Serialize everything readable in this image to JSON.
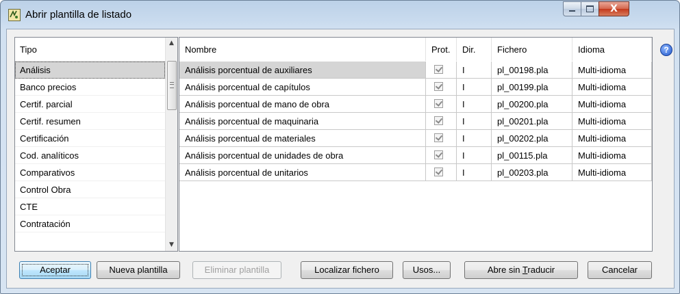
{
  "window": {
    "title": "Abrir plantilla de listado",
    "icon": "app-template-icon",
    "controls": {
      "minimize": "minimize-icon",
      "maximize": "maximize-icon",
      "close": "X"
    }
  },
  "left_list": {
    "header": "Tipo",
    "items": [
      {
        "label": "Análisis",
        "selected": true
      },
      {
        "label": "Banco precios"
      },
      {
        "label": "Certif. parcial"
      },
      {
        "label": "Certif. resumen"
      },
      {
        "label": "Certificación"
      },
      {
        "label": "Cod. analíticos"
      },
      {
        "label": "Comparativos"
      },
      {
        "label": "Control Obra"
      },
      {
        "label": "CTE"
      },
      {
        "label": "Contratación"
      }
    ]
  },
  "grid": {
    "columns": {
      "nombre": "Nombre",
      "prot": "Prot.",
      "dir": "Dir.",
      "fichero": "Fichero",
      "idioma": "Idioma"
    },
    "rows": [
      {
        "nombre": "Análisis porcentual de auxiliares",
        "prot": true,
        "dir": "I",
        "fichero": "pl_00198.pla",
        "idioma": "Multi-idioma",
        "selected": true
      },
      {
        "nombre": "Análisis porcentual de capítulos",
        "prot": true,
        "dir": "I",
        "fichero": "pl_00199.pla",
        "idioma": "Multi-idioma"
      },
      {
        "nombre": "Análisis porcentual de mano de obra",
        "prot": true,
        "dir": "I",
        "fichero": "pl_00200.pla",
        "idioma": "Multi-idioma"
      },
      {
        "nombre": "Análisis porcentual de maquinaria",
        "prot": true,
        "dir": "I",
        "fichero": "pl_00201.pla",
        "idioma": "Multi-idioma"
      },
      {
        "nombre": "Análisis porcentual de materiales",
        "prot": true,
        "dir": "I",
        "fichero": "pl_00202.pla",
        "idioma": "Multi-idioma"
      },
      {
        "nombre": "Análisis porcentual de unidades de obra",
        "prot": true,
        "dir": "I",
        "fichero": "pl_00115.pla",
        "idioma": "Multi-idioma"
      },
      {
        "nombre": "Análisis porcentual de unitarios",
        "prot": true,
        "dir": "I",
        "fichero": "pl_00203.pla",
        "idioma": "Multi-idioma"
      }
    ]
  },
  "help": {
    "glyph": "?"
  },
  "buttons": {
    "aceptar": "Aceptar",
    "nueva_plantilla": "Nueva plantilla",
    "eliminar_plantilla": "Eliminar plantilla",
    "localizar_fichero": "Localizar fichero",
    "usos": "Usos...",
    "abre_sin_traducir_pre": "Abre sin ",
    "abre_sin_traducir_mnemonic": "T",
    "abre_sin_traducir_post": "raducir",
    "cancelar": "Cancelar"
  },
  "colors": {
    "selection_gray": "#d5d5d5",
    "title_gradient": "#c9dbee",
    "close_red": "#c3391c",
    "default_button_blue": "#bee6fd"
  }
}
